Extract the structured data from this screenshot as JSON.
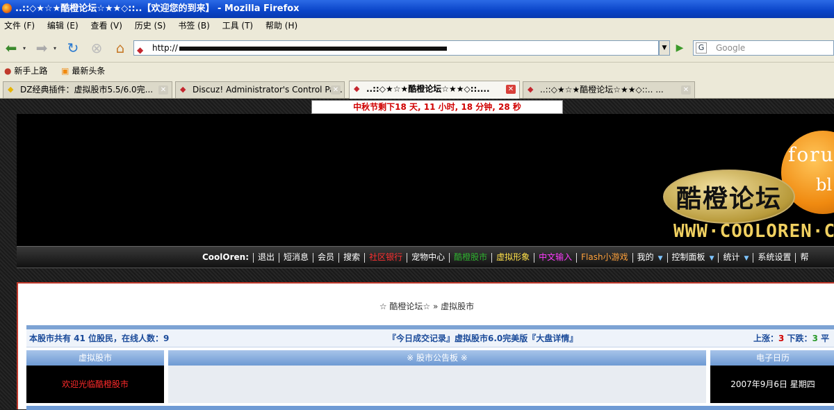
{
  "window": {
    "title": "..::◇★☆★酷橙论坛☆★★◇::..【欢迎您的到来】 - Mozilla Firefox"
  },
  "menu": [
    "文件 (F)",
    "编辑 (E)",
    "查看 (V)",
    "历史 (S)",
    "书签 (B)",
    "工具 (T)",
    "帮助 (H)"
  ],
  "nav": {
    "url_prefix": "http://",
    "search_placeholder": "Google"
  },
  "bookmarks": [
    "新手上路",
    "最新头条"
  ],
  "tabs": [
    "DZ经典插件：虚拟股市5.5/6.0完...",
    "Discuz! Administrator's Control Pa...",
    "..::◇★☆★酷橙论坛☆★★◇::....",
    "..::◇★☆★酷橙论坛☆★★◇::.. ..."
  ],
  "page": {
    "countdown": "中秋节剩下18 天, 11 小时, 18 分钟, 28 秒",
    "logo": {
      "cn": "酷橙论坛",
      "forum": "forum",
      "bl": "bl",
      "www": "WWW·COOLOREN·COM/"
    },
    "forumnav": {
      "brand": "CoolOren:",
      "items": [
        "退出",
        "短消息",
        "会员",
        "搜索",
        "社区银行",
        "宠物中心",
        "酷橙股市",
        "虚拟形象",
        "中文输入",
        "Flash小游戏",
        "我的",
        "控制面板",
        "统计",
        "系统设置",
        "帮"
      ]
    },
    "breadcrumb": "☆ 酷橙论坛☆ » 虚拟股市",
    "info": {
      "left": "本股市共有 41 位股民，在线人数：9",
      "center": "『今日成交记录』虚拟股市6.0完美版『大盘详情』",
      "right_up_label": "上涨：",
      "right_up": "3",
      "right_down_label": " 下跌：",
      "right_down": "3",
      "right_flat": " 平"
    },
    "panels": {
      "left_title": "虚拟股市",
      "left_text": "欢迎光临酷橙股市",
      "mid_title": "※ 股市公告板 ※",
      "right_title": "电子日历",
      "right_text": "2007年9月6日 星期四"
    }
  },
  "colors": {
    "bank": "#ff3030",
    "pet": "#ffffff",
    "stock": "#2fb02f",
    "avatar": "#ffe14a",
    "input": "#ff3cff",
    "flash": "#ffa23c"
  }
}
